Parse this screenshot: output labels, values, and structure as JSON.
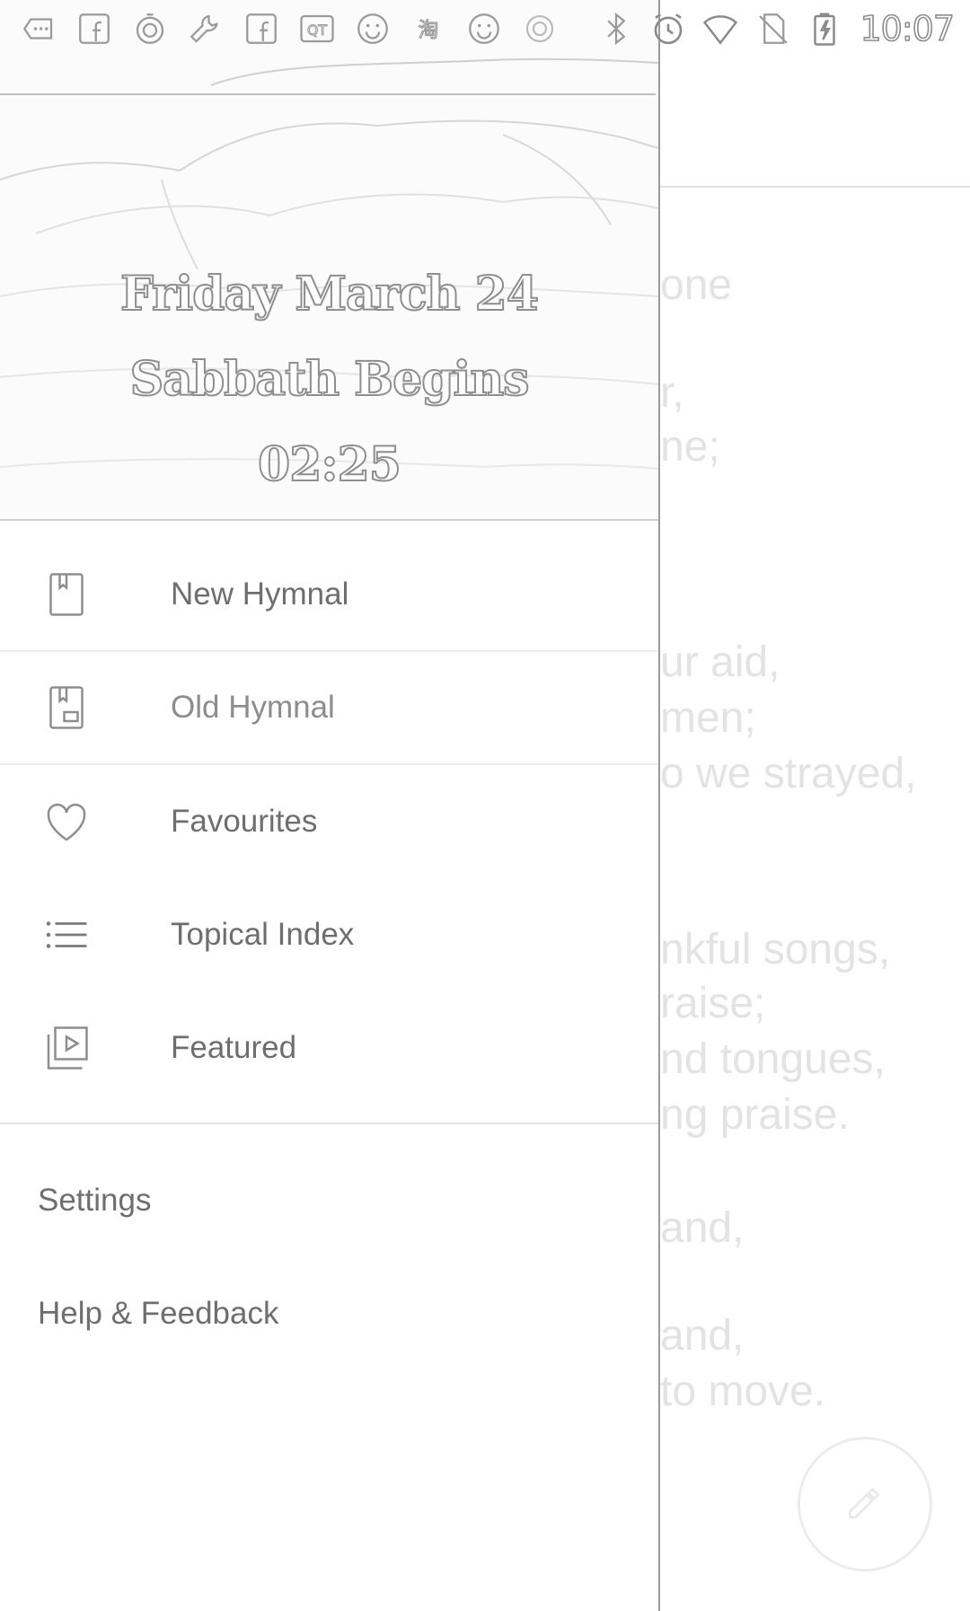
{
  "status_bar": {
    "time": "10:07",
    "left_icons": [
      "more-notifications-icon",
      "facebook-icon",
      "stopwatch-icon",
      "wrench-icon",
      "facebook-icon",
      "qq-icon",
      "smiley-icon",
      "taobao-icon",
      "smiley-icon",
      "info-icon"
    ],
    "right_icons": [
      "bluetooth-icon",
      "alarm-icon",
      "wifi-icon",
      "no-sim-icon",
      "battery-charging-icon"
    ]
  },
  "drawer": {
    "header": {
      "date": "Friday March 24",
      "event": "Sabbath Begins",
      "countdown": "02:25"
    },
    "items": [
      {
        "label": "New Hymnal",
        "icon": "book-icon"
      },
      {
        "label": "Old Hymnal",
        "icon": "old-book-icon"
      },
      {
        "label": "Favourites",
        "icon": "heart-icon"
      },
      {
        "label": "Topical Index",
        "icon": "list-icon"
      },
      {
        "label": "Featured",
        "icon": "video-library-icon"
      }
    ],
    "secondary_items": [
      {
        "label": "Settings"
      },
      {
        "label": "Help & Feedback"
      }
    ]
  },
  "background_content": {
    "lines": [
      "one",
      "r,",
      "ne;",
      "ur aid,",
      "men;",
      "o we strayed,",
      "",
      "nkful songs,",
      "raise;",
      "nd tongues,",
      "ng praise.",
      "and,",
      "and,",
      "to move."
    ],
    "fab_icon": "edit-icon"
  },
  "colors": {
    "drawer_text": "#6e6e6e",
    "divider": "#e4e4e4",
    "scrim_text": "#e3e3e3"
  }
}
